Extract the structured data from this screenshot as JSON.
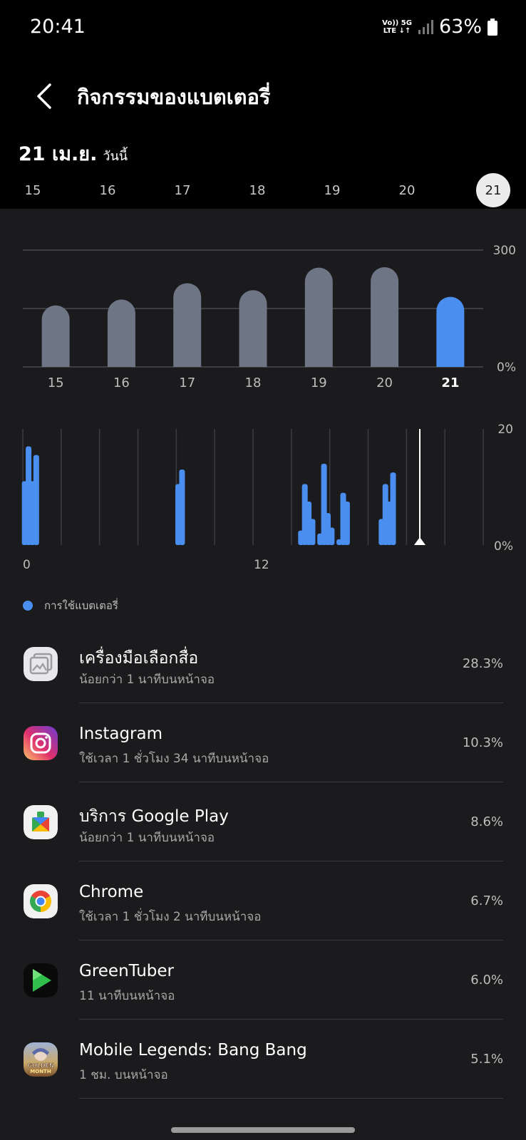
{
  "status_bar": {
    "time": "20:41",
    "net_top": "Vo)) 5G",
    "net_bottom": "LTE ↓↑",
    "battery": "63%"
  },
  "header": {
    "title": "กิจกรรมของแบตเตอรี่",
    "back_icon": "chevron-left-icon"
  },
  "date_heading": {
    "date": "21 เม.ย.",
    "label": "วันนี้"
  },
  "date_strip": {
    "days": [
      "15",
      "16",
      "17",
      "18",
      "19",
      "20",
      "21"
    ],
    "selected": "21"
  },
  "colors": {
    "accent": "#4a8ff0",
    "bar_inactive": "#6e7585",
    "panel": "#1b1b1d"
  },
  "chart_data": [
    {
      "type": "bar",
      "categories": [
        "15",
        "16",
        "17",
        "18",
        "19",
        "20",
        "21"
      ],
      "values": [
        158,
        173,
        215,
        197,
        255,
        256,
        180
      ],
      "highlighted": "21",
      "ylim": [
        0,
        300
      ],
      "y_tick_labels": [
        "300",
        "0%"
      ],
      "grid": true
    },
    {
      "type": "bar",
      "x_tick_labels": [
        "0",
        "12"
      ],
      "values": [
        11,
        17,
        11,
        15.5,
        0,
        0,
        0,
        0,
        0,
        0,
        0,
        0,
        0,
        0,
        0,
        0,
        0,
        0,
        0,
        0,
        0,
        0,
        0,
        0,
        0,
        0,
        0,
        0,
        0,
        0,
        0,
        0,
        0,
        0,
        0,
        0,
        0,
        0,
        0,
        0,
        10.5,
        13,
        0,
        0,
        0,
        0,
        0,
        0,
        0,
        0,
        0,
        0,
        0,
        0,
        0,
        0,
        0,
        0,
        0,
        0,
        0,
        0,
        0,
        0,
        0,
        0,
        0,
        0,
        0,
        0,
        0,
        0,
        2.5,
        10.5,
        7.5,
        4.5,
        0,
        2,
        14,
        5.5,
        3,
        0,
        1,
        9,
        7.5,
        0,
        0,
        0,
        0,
        0,
        0,
        0,
        0,
        4.5,
        10.5,
        7.5,
        12.5,
        0,
        0,
        0,
        0,
        0,
        0,
        0,
        0,
        0,
        0,
        0,
        0,
        0,
        0,
        0,
        0,
        0,
        0,
        0,
        0,
        0,
        0,
        0
      ],
      "ylim": [
        0,
        20
      ],
      "y_tick_labels": [
        "20",
        "0%"
      ],
      "current_marker": true
    }
  ],
  "legend": {
    "label": "การใช้แบตเตอรี่"
  },
  "apps": [
    {
      "name": "เครื่องมือเลือกสื่อ",
      "usage": "น้อยกว่า 1 นาทีบนหน้าจอ",
      "percent": "28.3%",
      "icon": "media-picker-icon"
    },
    {
      "name": "Instagram",
      "usage": "ใช้เวลา 1 ชั่วโมง 34 นาทีบนหน้าจอ",
      "percent": "10.3%",
      "icon": "instagram-icon"
    },
    {
      "name": "บริการ Google Play",
      "usage": "น้อยกว่า 1 นาทีบนหน้าจอ",
      "percent": "8.6%",
      "icon": "google-play-services-icon"
    },
    {
      "name": "Chrome",
      "usage": "ใช้เวลา 1 ชั่วโมง 2 นาทีบนหน้าจอ",
      "percent": "6.7%",
      "icon": "chrome-icon"
    },
    {
      "name": "GreenTuber",
      "usage": "11 นาทีบนหน้าจอ",
      "percent": "6.0%",
      "icon": "greentuber-icon"
    },
    {
      "name": "Mobile Legends: Bang Bang",
      "usage": "1 ชม. บนหน้าจอ",
      "percent": "5.1%",
      "icon": "mobile-legends-icon",
      "icon_text": [
        "GOLDEN",
        "MONTH"
      ]
    }
  ]
}
